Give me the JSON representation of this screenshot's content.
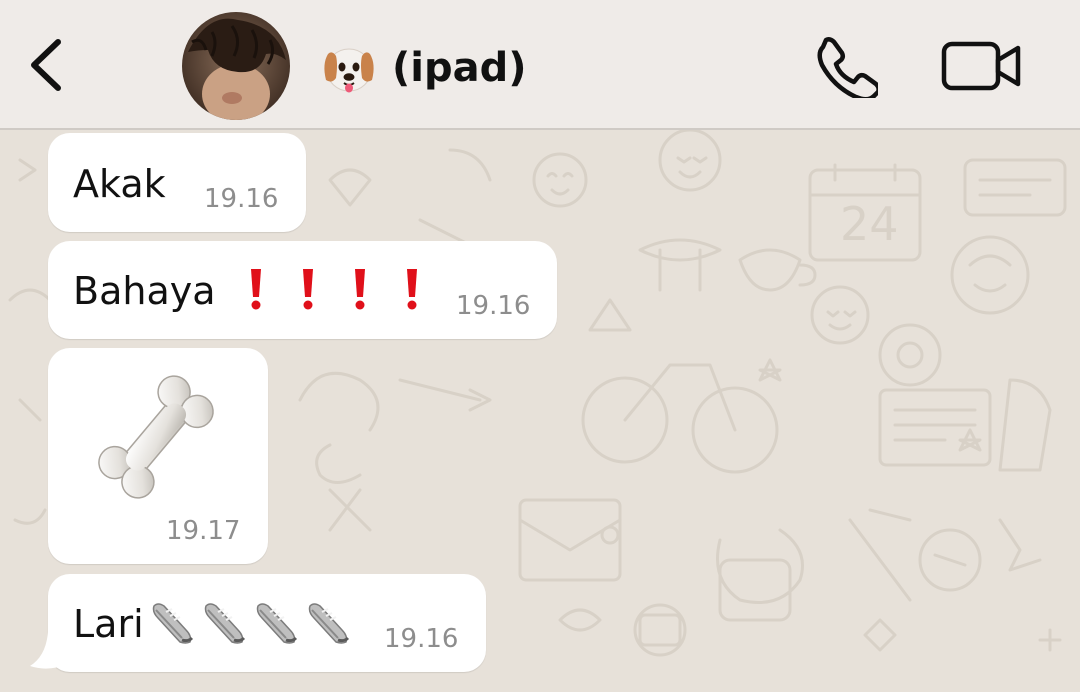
{
  "header": {
    "back_icon": "chevron-left-icon",
    "avatar": "contact-avatar-photo",
    "contact_emoji": "dog-face-icon",
    "contact_name": "(ipad)",
    "call_icon": "phone-icon",
    "video_icon": "video-camera-icon"
  },
  "colors": {
    "header_bg": "#efebe8",
    "chat_bg": "#e7e1d9",
    "bubble_bg": "#ffffff",
    "time_text": "#8d8d8d",
    "exclamation": "#e0101a"
  },
  "messages": [
    {
      "text": "Akak",
      "time": "19.16"
    },
    {
      "text": "Bahaya",
      "emoji": "red-exclamation-icon",
      "emoji_count": 4,
      "time": "19.16"
    },
    {
      "emoji": "bone-icon",
      "time": "19.17"
    },
    {
      "text": "Lari",
      "emoji": "sneaker-icon",
      "emoji_count": 4,
      "time": "19.16"
    }
  ]
}
